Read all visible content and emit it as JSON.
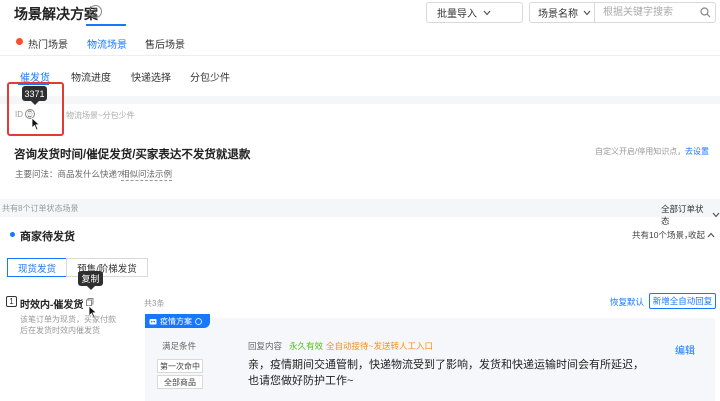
{
  "header": {
    "title": "场景解决方案",
    "help_icon": "question-circle-icon",
    "batch_import_label": "批量导入",
    "search_field_label": "场景名称",
    "search_placeholder": "根据关键字搜索"
  },
  "main_tabs": [
    {
      "label": "热门场景"
    },
    {
      "label": "物流场景"
    },
    {
      "label": "售后场景"
    }
  ],
  "sub_tabs": [
    {
      "label": "催发货"
    },
    {
      "label": "物流进度"
    },
    {
      "label": "快递选择"
    },
    {
      "label": "分包少件"
    }
  ],
  "tooltip_id": "3371",
  "scene_meta": {
    "id_label": "ID",
    "path": "物流场景~分包少件"
  },
  "scene": {
    "title": "咨询发货时间/催促发货/买家表达不发货就退款",
    "question_label": "主要问法：商品发什么快递?",
    "question_link": "相似问法示例",
    "custom_text": "自定义开启/停用知识点，",
    "custom_link": "去设置"
  },
  "order_band": {
    "count_text": "共有8个订单状态场景",
    "filter_label": "全部订单状态"
  },
  "merchant": {
    "title": "商家待发货",
    "summary": "共有10个场景，",
    "collapse_label": "收起",
    "type_tabs": [
      {
        "label": "现货发货"
      },
      {
        "label": "预售/阶梯发货"
      }
    ],
    "copy_tooltip": "复制"
  },
  "card": {
    "number": "1",
    "title": "时效内-催发货",
    "desc": "该笔订单为现货，买家付款后在发货时效内催发货"
  },
  "list": {
    "count_text": "共3条",
    "restore_label": "恢复默认",
    "add_label": "新增全自动回复"
  },
  "plan": {
    "tag_label": "疫情方案",
    "cond_label": "满足条件",
    "cond_chips": [
      "第一次命中",
      "全部商品"
    ],
    "reply_label": "回复内容",
    "tag_forever": "永久有效",
    "tag_auto": "全自动接待~发送转人工入口",
    "edit_label": "编辑",
    "reply_text": "亲，疫情期间交通管制，快递物流受到了影响，发货和快递运输时间会有所延迟，也请您做好防护工作~"
  },
  "colors": {
    "accent": "#1677ff",
    "hot_dot": "#ff4d2e",
    "highlight_box": "#e53935",
    "success": "#52c41a",
    "warning": "#fa8c16"
  }
}
